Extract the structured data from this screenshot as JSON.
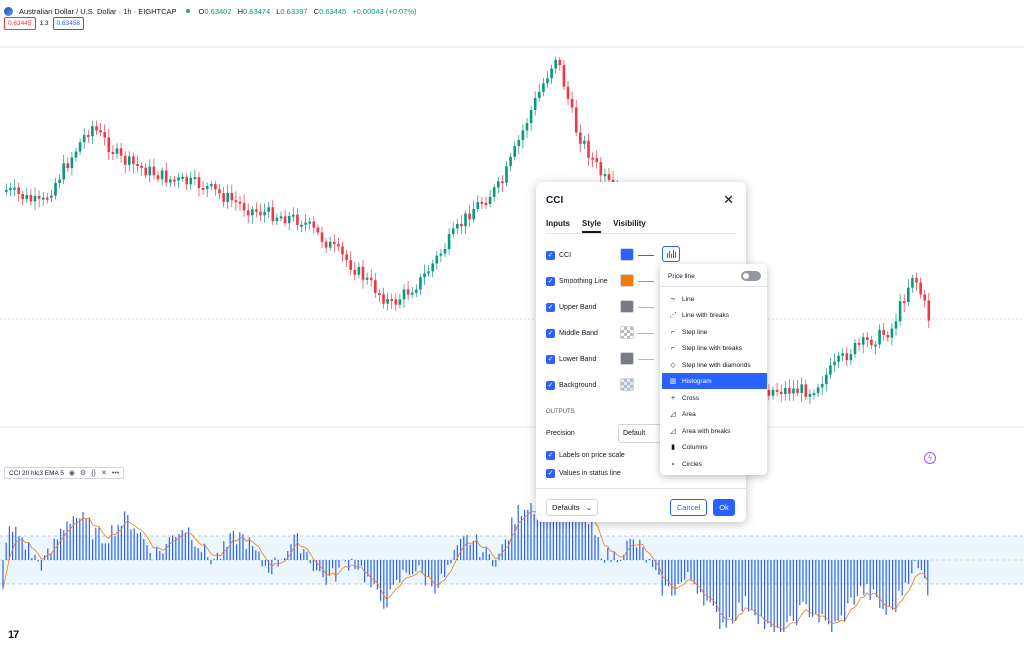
{
  "header": {
    "symbol": "Australian Dollar / U.S. Dollar · 1h · EIGHTCAP",
    "ohlc": [
      {
        "k": "O",
        "v": "0.63402"
      },
      {
        "k": "H",
        "v": "0.63474"
      },
      {
        "k": "L",
        "v": "0.63397"
      },
      {
        "k": "C",
        "v": "0.63445"
      },
      {
        "k": "",
        "v": "+0.00043 (+0.07%)"
      }
    ],
    "sell_price": "0.63445",
    "spread": "1.3",
    "buy_price": "0.63458"
  },
  "indicator_legend": {
    "label": "CCI 20 hlc3 EMA 5"
  },
  "colors": {
    "up": "#089981",
    "down": "#f23645",
    "accent": "#2962ff",
    "cci_line": "#2962ff",
    "smoothing": "#f57c00"
  },
  "dialog": {
    "title": "CCI",
    "tabs": [
      "Inputs",
      "Style",
      "Visibility"
    ],
    "active_tab": "Style",
    "rows": [
      {
        "label": "CCI",
        "color": "#2962ff"
      },
      {
        "label": "Smoothing Line",
        "color": "#f57c00"
      },
      {
        "label": "Upper Band",
        "color": "#787b86"
      },
      {
        "label": "Middle Band",
        "color": "#787b86"
      },
      {
        "label": "Lower Band",
        "color": "#787b86"
      },
      {
        "label": "Background",
        "color": "#2196f3"
      }
    ],
    "outputs_label": "OUTPUTS",
    "precision_label": "Precision",
    "precision_value": "Default",
    "labels_on_scale": "Labels on price scale",
    "values_in_status": "Values in status line",
    "defaults_label": "Defaults",
    "cancel_label": "Cancel",
    "ok_label": "Ok"
  },
  "plot_type_menu": {
    "price_line_label": "Price line",
    "items": [
      {
        "label": "Line",
        "icon": "line-icon"
      },
      {
        "label": "Line with breaks",
        "icon": "line-breaks-icon"
      },
      {
        "label": "Step line",
        "icon": "step-line-icon"
      },
      {
        "label": "Step line with breaks",
        "icon": "step-breaks-icon"
      },
      {
        "label": "Step line with diamonds",
        "icon": "step-diamonds-icon"
      },
      {
        "label": "Histogram",
        "icon": "histogram-icon"
      },
      {
        "label": "Cross",
        "icon": "cross-icon"
      },
      {
        "label": "Area",
        "icon": "area-icon"
      },
      {
        "label": "Area with breaks",
        "icon": "area-breaks-icon"
      },
      {
        "label": "Columns",
        "icon": "columns-icon"
      },
      {
        "label": "Circles",
        "icon": "circles-icon"
      }
    ],
    "selected": "Histogram"
  }
}
